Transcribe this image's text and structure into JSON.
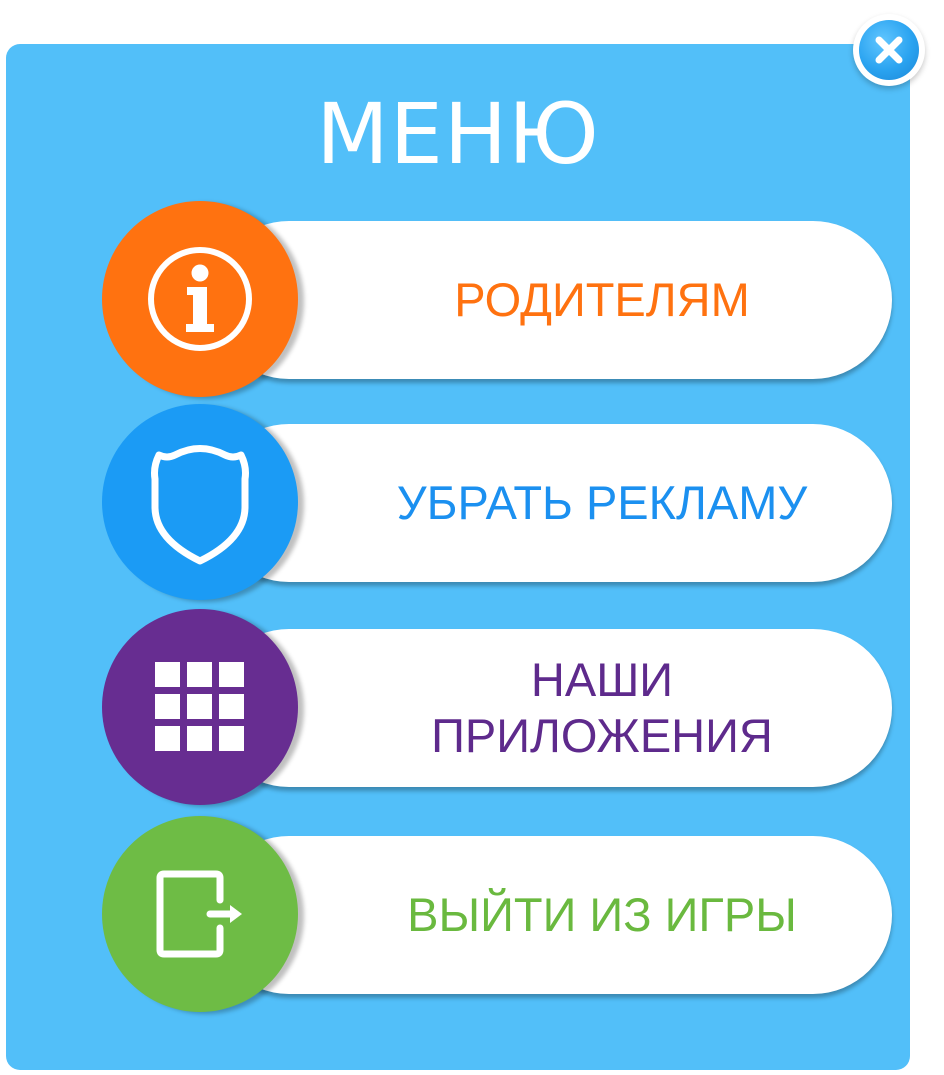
{
  "title": "МЕНЮ",
  "close_icon": "close-icon",
  "colors": {
    "panel_background": "#52bff9",
    "parents": "#ff7210",
    "remove_ads": "#1b9bf5",
    "our_apps": "#672d91",
    "exit_game": "#6ebc45"
  },
  "menu": {
    "items": [
      {
        "id": "parents",
        "label": "РОДИТЕЛЯМ",
        "icon": "info-icon"
      },
      {
        "id": "remove_ads",
        "label": "УБРАТЬ РЕКЛАМУ",
        "icon": "shield-icon"
      },
      {
        "id": "our_apps",
        "label": "НАШИ\nПРИЛОЖЕНИЯ",
        "icon": "grid-icon"
      },
      {
        "id": "exit_game",
        "label": "ВЫЙТИ ИЗ ИГРЫ",
        "icon": "exit-icon"
      }
    ]
  }
}
